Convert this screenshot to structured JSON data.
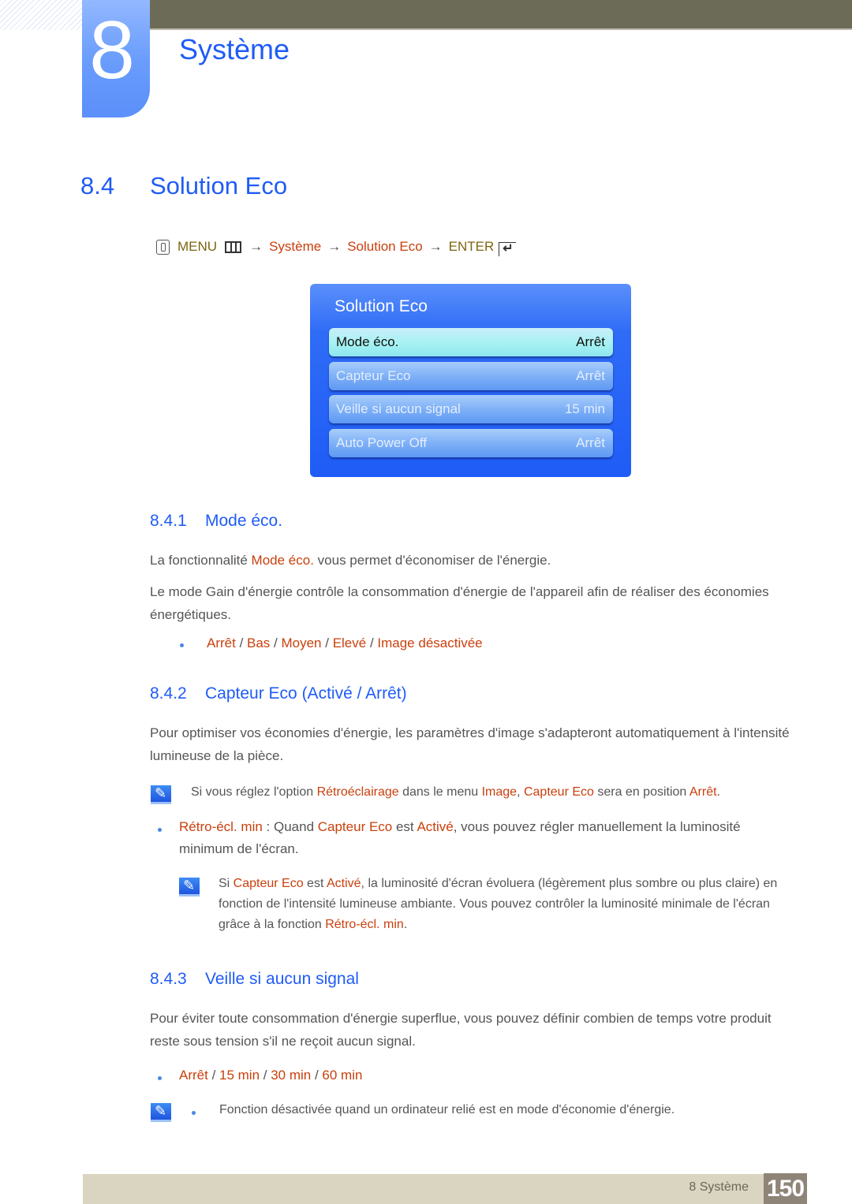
{
  "chapter": {
    "number": "8",
    "title": "Système"
  },
  "section": {
    "number": "8.4",
    "title": "Solution Eco"
  },
  "menu_path": {
    "menu_label": "MENU",
    "steps": [
      "Système",
      "Solution Eco"
    ],
    "enter_label": "ENTER",
    "arrow": "→",
    "icons": [
      "hand-touch-icon",
      "menu-grid-icon",
      "enter-icon"
    ]
  },
  "osd": {
    "title": "Solution Eco",
    "items": [
      {
        "label": "Mode éco.",
        "value": "Arrêt",
        "selected": true
      },
      {
        "label": "Capteur Eco",
        "value": "Arrêt",
        "selected": false
      },
      {
        "label": "Veille si aucun signal",
        "value": "15 min",
        "selected": false
      },
      {
        "label": "Auto Power Off",
        "value": "Arrêt",
        "selected": false
      }
    ]
  },
  "sub1": {
    "number": "8.4.1",
    "title": "Mode éco.",
    "p1_pre": "La fonctionnalité ",
    "p1_hl": "Mode éco.",
    "p1_post": " vous permet d'économiser de l'énergie.",
    "p2": "Le mode Gain d'énergie contrôle la consommation d'énergie de l'appareil afin de réaliser des économies énergétiques.",
    "options": [
      "Arrêt",
      "Bas",
      "Moyen",
      "Elevé",
      "Image désactivée"
    ],
    "sep": " / "
  },
  "sub2": {
    "number": "8.4.2",
    "title": "Capteur Eco (Activé / Arrêt)",
    "p1": "Pour optimiser vos économies d'énergie, les paramètres d'image s'adapteront automatiquement à l'intensité lumineuse de la pièce.",
    "note1": [
      "Si vous réglez l'option ",
      "Rétroéclairage",
      " dans le menu ",
      "Image",
      ", ",
      "Capteur Eco",
      " sera en position ",
      "Arrêt",
      "."
    ],
    "bullet": [
      "Rétro-écl. min",
      " : Quand ",
      "Capteur Eco",
      " est ",
      "Activé",
      ", vous pouvez régler manuellement la luminosité minimum de l'écran."
    ],
    "note2": [
      "Si ",
      "Capteur Eco",
      " est ",
      "Activé",
      ", la luminosité d'écran évoluera (légèrement plus sombre ou plus claire) en fonction de l'intensité lumineuse ambiante. Vous pouvez contrôler la luminosité minimale de l'écran grâce à la fonction ",
      "Rétro-écl. min",
      "."
    ]
  },
  "sub3": {
    "number": "8.4.3",
    "title": "Veille si aucun signal",
    "p1": "Pour éviter toute consommation d'énergie superflue, vous pouvez définir combien de temps votre produit reste sous tension s'il ne reçoit aucun signal.",
    "options": [
      "Arrêt",
      "15 min",
      "30 min",
      "60 min"
    ],
    "note": "Fonction désactivée quand un ordinateur relié est en mode d'économie d'énergie."
  },
  "footer": {
    "label": "8 Système",
    "page": "150"
  },
  "colors": {
    "heading_blue": "#1f5cf6",
    "highlight_orange": "#c9400d",
    "menu_olive": "#7d6510",
    "topbar": "#6c6b57",
    "footer_bg": "#d9d5c0",
    "page_box": "#8f8478"
  }
}
